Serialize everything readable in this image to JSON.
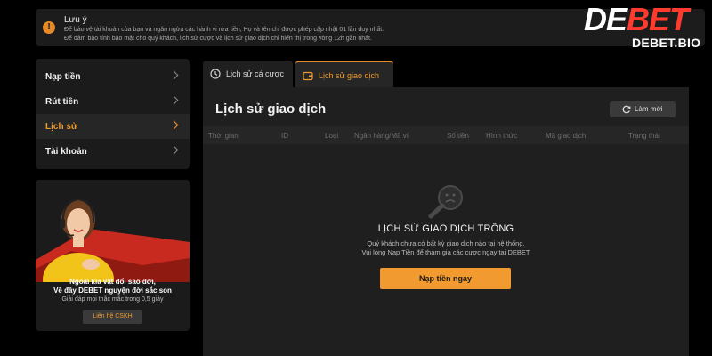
{
  "notice": {
    "icon": "warning-icon",
    "title": "Lưu ý",
    "lines": [
      "Để bảo vệ tài khoản của bạn và ngăn ngừa các hành vi rửa tiền, Họ và tên chỉ được phép cập nhật 01 lần duy nhất.",
      "Để đảm bảo tính bảo mật cho quý khách, lịch sử cược và lịch sử giao dịch chỉ hiển thị trong vòng 12h gần nhất."
    ],
    "accent_color": "#e58a2a"
  },
  "logo": {
    "main_prefix": "DE",
    "main_suffix": "BET",
    "sub": "DEBET.BIO",
    "accent_color": "#ff3b2f"
  },
  "sidebar": {
    "items": [
      {
        "label": "Nạp tiền",
        "active": false
      },
      {
        "label": "Rút tiền",
        "active": false
      },
      {
        "label": "Lịch sử",
        "active": true
      },
      {
        "label": "Tài khoản",
        "active": false
      }
    ],
    "active_color": "#f19a2f"
  },
  "promo": {
    "line1": "Ngoài kia vật đổi sao dời,",
    "line2": "Về đây DEBET nguyện đời sắc son",
    "sub": "Giải đáp mọi thắc mắc trong 0,5 giây",
    "button": "Liên hệ CSKH"
  },
  "tabs": [
    {
      "label": "Lịch sử cá cược",
      "icon": "history-icon",
      "active": false
    },
    {
      "label": "Lịch sử giao dịch",
      "icon": "wallet-icon",
      "active": true
    }
  ],
  "main": {
    "title": "Lịch sử giao dịch",
    "refresh_label": "Làm mới",
    "columns": [
      "Thời gian",
      "ID",
      "Loại",
      "Ngân hàng/Mã ví",
      "Số tiền",
      "Hình thức",
      "Mã giao dịch",
      "Trạng thái"
    ],
    "empty": {
      "icon": "sad-magnifier-icon",
      "title": "LỊCH SỬ GIAO DỊCH TRỐNG",
      "line1": "Quý khách chưa có bất kỳ giao dịch nào tại hệ thống.",
      "line2": "Vui lòng Nạp Tiền để tham gia các cược ngay tại DEBET",
      "button": "Nạp tiền ngay"
    }
  },
  "colors": {
    "background": "#000000",
    "panel": "#1f1f1f",
    "primary": "#f19a2f"
  }
}
